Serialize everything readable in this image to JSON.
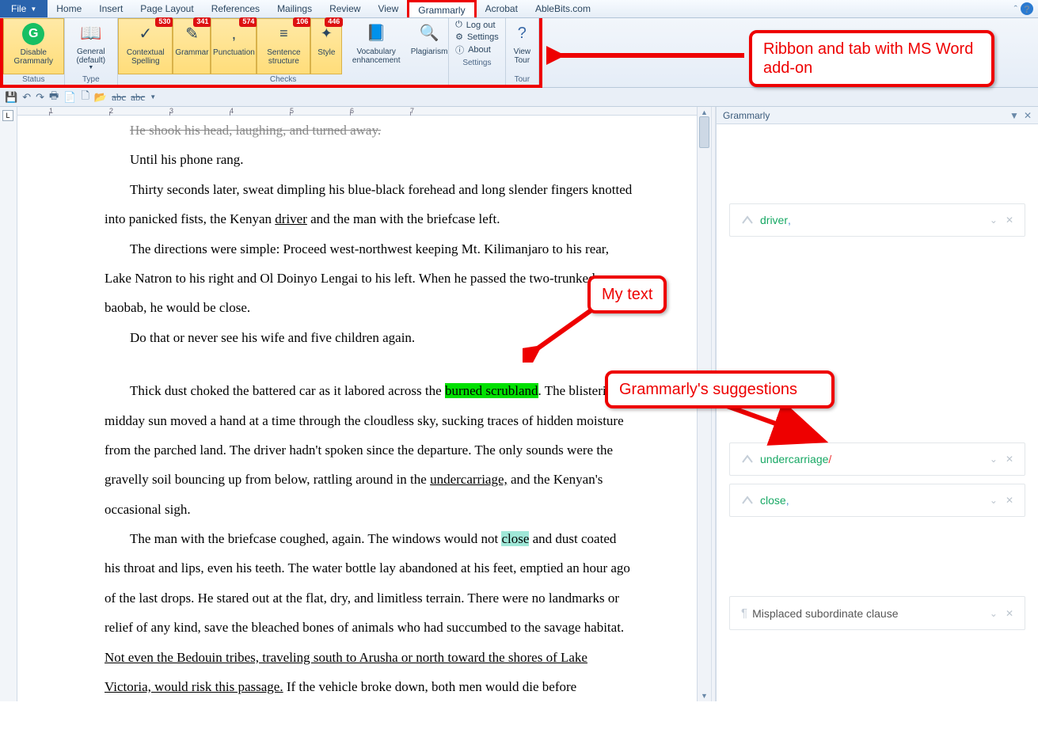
{
  "tabs": {
    "file": "File",
    "items": [
      "Home",
      "Insert",
      "Page Layout",
      "References",
      "Mailings",
      "Review",
      "View",
      "Grammarly",
      "Acrobat",
      "AbleBits.com"
    ],
    "active": "Grammarly"
  },
  "ribbon": {
    "disable": "Disable Grammarly",
    "status_label": "Status",
    "general": "General (default)",
    "type_label": "Type",
    "checks_label": "Checks",
    "contextual": "Contextual Spelling",
    "contextual_badge": "530",
    "grammar": "Grammar",
    "grammar_badge": "341",
    "punctuation": "Punctuation",
    "punctuation_badge": "574",
    "sentence": "Sentence structure",
    "sentence_badge": "106",
    "style": "Style",
    "style_badge": "446",
    "vocab": "Vocabulary enhancement",
    "plagiarism": "Plagiarism",
    "logout": "Log out",
    "settings": "Settings",
    "about": "About",
    "settings_label": "Settings",
    "viewtour": "View Tour",
    "tour_label": "Tour"
  },
  "ruler_ticks": [
    "1",
    "2",
    "3",
    "4",
    "5",
    "6",
    "7"
  ],
  "document": {
    "p0": "He shook his head, laughing, and turned away.",
    "p1": "Until his phone rang.",
    "p2a": "Thirty seconds later, sweat dimpling his blue-black forehead and long slender fingers knotted into panicked fists, the Kenyan ",
    "p2b": "driver",
    "p2c": " and the man with the briefcase left.",
    "p3": "The directions were simple: Proceed west-northwest keeping Mt. Kilimanjaro to his rear, Lake Natron to his right and Ol Doinyo Lengai to his left. When he passed the two-trunked baobab, he would be close.",
    "p4": "Do that or never see his wife and five children again.",
    "p5a": "Thick dust choked the battered car as it labored across the ",
    "p5b": "burned scrubland",
    "p5c": ". The blistering midday sun moved a hand at a time through the cloudless sky, sucking traces of hidden moisture from the parched land.  The driver hadn't spoken since the departure. The only sounds were the gravelly soil bouncing up from below, rattling around in the ",
    "p5d": "undercarriage,",
    "p5e": " and the Kenyan's occasional sigh.",
    "p6a": "The man with the briefcase coughed, again. The windows would not ",
    "p6b": "close",
    "p6c": " and dust coated his throat and lips, even his teeth. The water bottle lay abandoned at his feet, emptied an hour ago of the last drops. He stared out at the flat, dry, and limitless terrain. There were no landmarks or relief of any kind, save the bleached bones of animals who had succumbed to the savage habitat. ",
    "p6d": "Not even the Bedouin tribes, traveling south to Arusha or north toward the shores of Lake Victoria, would risk this passage.",
    "p6e": " If the vehicle broke down, both men would die before"
  },
  "panel": {
    "title": "Grammarly",
    "cards": {
      "c1_word": "driver",
      "c1_punc": ",",
      "c2_word": "undercarriage",
      "c2_punc": "/",
      "c3_word": "close",
      "c3_punc": ",",
      "c4_text": "Misplaced subordinate clause"
    }
  },
  "callouts": {
    "ribbon": "Ribbon and tab with MS Word add-on",
    "mytext": "My text",
    "suggestions": "Grammarly's suggestions"
  }
}
